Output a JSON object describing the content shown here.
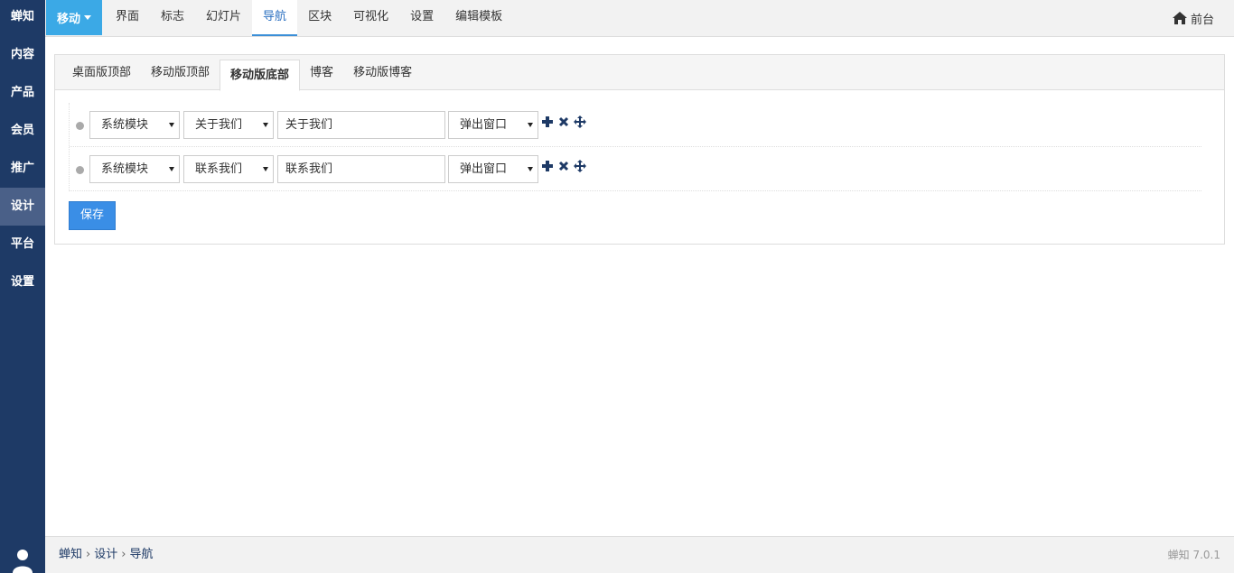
{
  "sidebar": {
    "brand": "蝉知",
    "items": [
      {
        "label": "内容"
      },
      {
        "label": "产品"
      },
      {
        "label": "会员"
      },
      {
        "label": "推广"
      },
      {
        "label": "设计"
      },
      {
        "label": "平台"
      },
      {
        "label": "设置"
      }
    ],
    "active_index": 4
  },
  "topbar": {
    "device_label": "移动",
    "tabs": [
      "界面",
      "标志",
      "幻灯片",
      "导航",
      "区块",
      "可视化",
      "设置",
      "编辑模板"
    ],
    "active_tab": "导航",
    "frontend_label": "前台"
  },
  "panel": {
    "tabs": [
      "桌面版顶部",
      "移动版顶部",
      "移动版底部",
      "博客",
      "移动版博客"
    ],
    "active_tab": "移动版底部",
    "rows": [
      {
        "type": "系统模块",
        "page": "关于我们",
        "title": "关于我们",
        "target": "弹出窗口"
      },
      {
        "type": "系统模块",
        "page": "联系我们",
        "title": "联系我们",
        "target": "弹出窗口"
      }
    ],
    "save_label": "保存"
  },
  "footer": {
    "breadcrumb": [
      "蝉知",
      "设计",
      "导航"
    ],
    "version": "蝉知 7.0.1"
  },
  "colors": {
    "sidebar": "#1e3a66",
    "accent": "#3ba9e6",
    "primary_button": "#3a8ee6",
    "icon_blue": "#1e3a66"
  }
}
